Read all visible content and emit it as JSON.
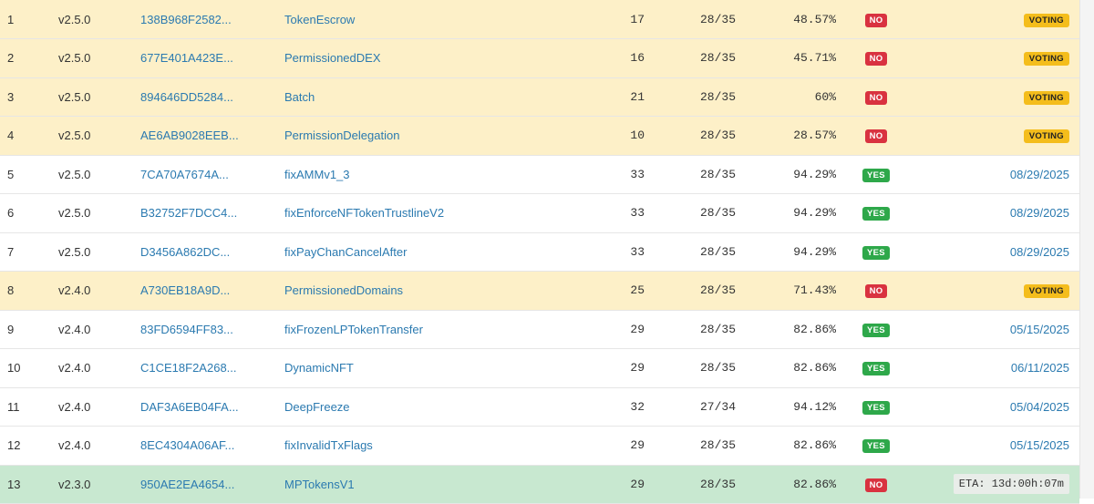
{
  "rows": [
    {
      "num": "1",
      "ver": "v2.5.0",
      "hash": "138B968F2582...",
      "name": "TokenEscrow",
      "count": "17",
      "threshold": "28/35",
      "pct": "48.57%",
      "majority": "NO",
      "status": "VOTING",
      "kind": "voting"
    },
    {
      "num": "2",
      "ver": "v2.5.0",
      "hash": "677E401A423E...",
      "name": "PermissionedDEX",
      "count": "16",
      "threshold": "28/35",
      "pct": "45.71%",
      "majority": "NO",
      "status": "VOTING",
      "kind": "voting"
    },
    {
      "num": "3",
      "ver": "v2.5.0",
      "hash": "894646DD5284...",
      "name": "Batch",
      "count": "21",
      "threshold": "28/35",
      "pct": "60%",
      "majority": "NO",
      "status": "VOTING",
      "kind": "voting"
    },
    {
      "num": "4",
      "ver": "v2.5.0",
      "hash": "AE6AB9028EEB...",
      "name": "PermissionDelegation",
      "count": "10",
      "threshold": "28/35",
      "pct": "28.57%",
      "majority": "NO",
      "status": "VOTING",
      "kind": "voting"
    },
    {
      "num": "5",
      "ver": "v2.5.0",
      "hash": "7CA70A7674A...",
      "name": "fixAMMv1_3",
      "count": "33",
      "threshold": "28/35",
      "pct": "94.29%",
      "majority": "YES",
      "status": "08/29/2025",
      "kind": "enabled"
    },
    {
      "num": "6",
      "ver": "v2.5.0",
      "hash": "B32752F7DCC4...",
      "name": "fixEnforceNFTokenTrustlineV2",
      "count": "33",
      "threshold": "28/35",
      "pct": "94.29%",
      "majority": "YES",
      "status": "08/29/2025",
      "kind": "enabled"
    },
    {
      "num": "7",
      "ver": "v2.5.0",
      "hash": "D3456A862DC...",
      "name": "fixPayChanCancelAfter",
      "count": "33",
      "threshold": "28/35",
      "pct": "94.29%",
      "majority": "YES",
      "status": "08/29/2025",
      "kind": "enabled"
    },
    {
      "num": "8",
      "ver": "v2.4.0",
      "hash": "A730EB18A9D...",
      "name": "PermissionedDomains",
      "count": "25",
      "threshold": "28/35",
      "pct": "71.43%",
      "majority": "NO",
      "status": "VOTING",
      "kind": "voting"
    },
    {
      "num": "9",
      "ver": "v2.4.0",
      "hash": "83FD6594FF83...",
      "name": "fixFrozenLPTokenTransfer",
      "count": "29",
      "threshold": "28/35",
      "pct": "82.86%",
      "majority": "YES",
      "status": "05/15/2025",
      "kind": "enabled"
    },
    {
      "num": "10",
      "ver": "v2.4.0",
      "hash": "C1CE18F2A268...",
      "name": "DynamicNFT",
      "count": "29",
      "threshold": "28/35",
      "pct": "82.86%",
      "majority": "YES",
      "status": "06/11/2025",
      "kind": "enabled"
    },
    {
      "num": "11",
      "ver": "v2.4.0",
      "hash": "DAF3A6EB04FA...",
      "name": "DeepFreeze",
      "count": "32",
      "threshold": "27/34",
      "pct": "94.12%",
      "majority": "YES",
      "status": "05/04/2025",
      "kind": "enabled"
    },
    {
      "num": "12",
      "ver": "v2.4.0",
      "hash": "8EC4304A06AF...",
      "name": "fixInvalidTxFlags",
      "count": "29",
      "threshold": "28/35",
      "pct": "82.86%",
      "majority": "YES",
      "status": "05/15/2025",
      "kind": "enabled"
    },
    {
      "num": "13",
      "ver": "v2.3.0",
      "hash": "950AE2EA4654...",
      "name": "MPTokensV1",
      "count": "29",
      "threshold": "28/35",
      "pct": "82.86%",
      "majority": "NO",
      "status": "ETA: 13d:00h:07m",
      "kind": "eta"
    }
  ]
}
